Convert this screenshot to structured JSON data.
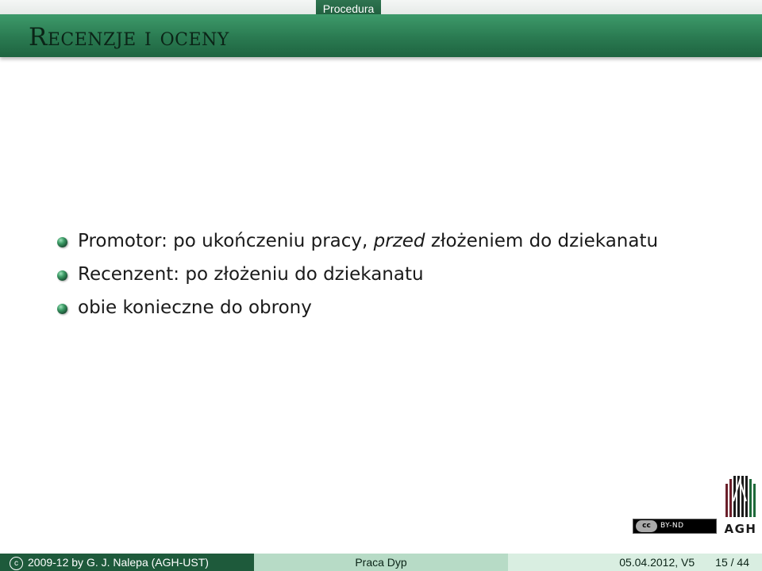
{
  "header": {
    "section": "Procedura"
  },
  "frame": {
    "title": "Recenzje i oceny"
  },
  "bullets": [
    {
      "text": "Promotor: po ukończeniu pracy, ",
      "emph": "przed",
      "rest": " złożeniem do dziekanatu"
    },
    {
      "text": "Recenzent: po złożeniu do dziekanatu"
    },
    {
      "text": "obie konieczne do obrony"
    }
  ],
  "license": {
    "cc_label": "cc",
    "terms": "BY-ND"
  },
  "logo": {
    "label": "AGH",
    "colors": [
      "#6b1f2a",
      "#1a1a1a",
      "#1f6a3a"
    ]
  },
  "footer": {
    "copyright_symbol": "c",
    "author": "2009-12 by G. J. Nalepa  (AGH-UST)",
    "title": "Praca Dyp",
    "date_version": "05.04.2012, V5",
    "page": "15 / 44"
  },
  "colors": {
    "theme_green": "#2a7a51",
    "footer_dark": "#1e5a3b",
    "footer_mid": "#b7dbc6",
    "footer_light": "#d9eee1"
  }
}
